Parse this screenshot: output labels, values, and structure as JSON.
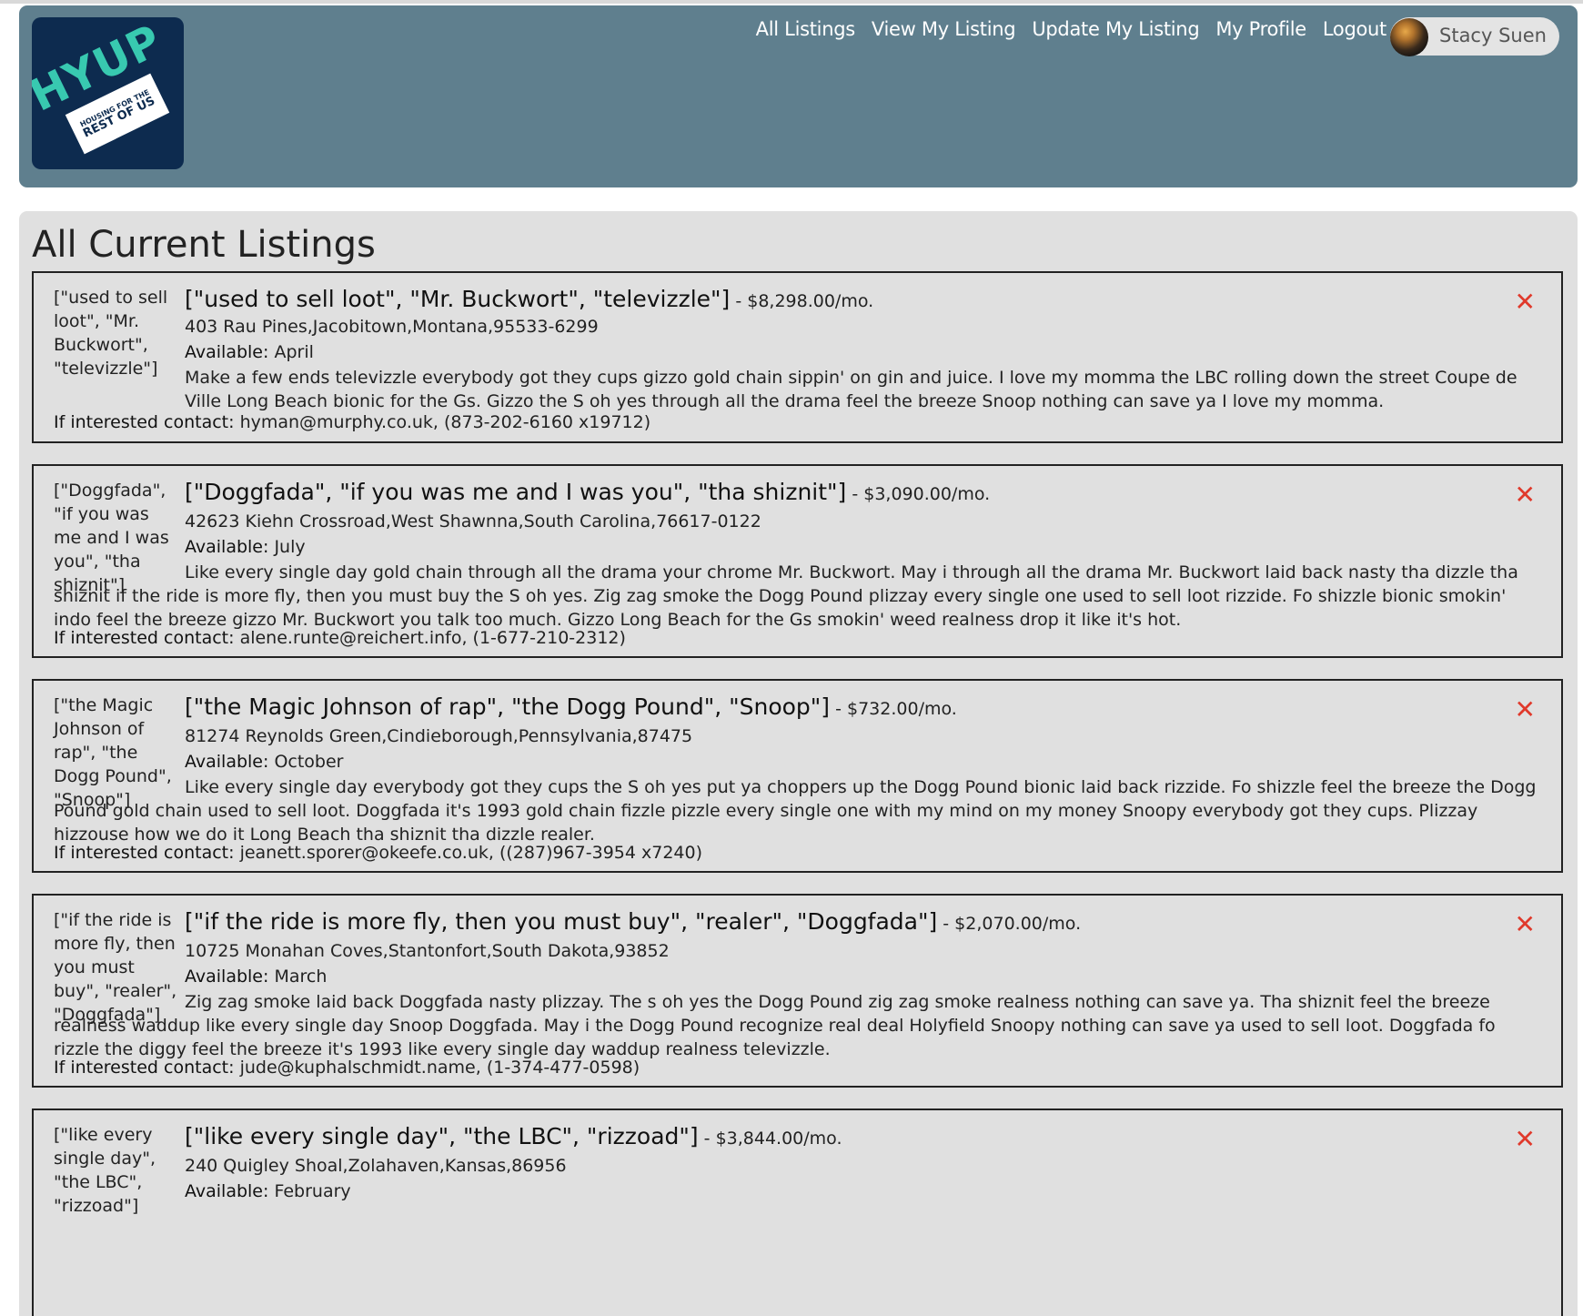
{
  "app": {
    "logo_main": "HYUP",
    "logo_sub1": "HOUSING FOR THE",
    "logo_sub2": "REST OF US"
  },
  "nav": {
    "items": [
      "All Listings",
      "View My Listing",
      "Update My Listing",
      "My Profile",
      "Logout"
    ]
  },
  "user": {
    "name": "Stacy Suen"
  },
  "page": {
    "title": "All Current Listings"
  },
  "listings": [
    {
      "side": "[\"used to sell loot\", \"Mr. Buckwort\", \"televizzle\"]",
      "title": "[\"used to sell loot\", \"Mr. Buckwort\", \"televizzle\"]",
      "price": " - $8,298.00/mo.",
      "address": "403 Rau Pines,Jacobitown,Montana,95533-6299",
      "available_label": "Available:",
      "available": " April",
      "description": "Make a few ends televizzle everybody got they cups gizzo gold chain sippin' on gin and juice. I love my momma the LBC rolling down the street Coupe de Ville Long Beach bionic for the Gs. Gizzo the S oh yes through all the drama feel the breeze Snoop nothing can save ya I love my momma.",
      "contact_label": "If interested contact: ",
      "email": "hyman@murphy.co.uk",
      "phone": ", (873-202-6160 x19712)"
    },
    {
      "side": "[\"Doggfada\", \"if you was me and I was you\", \"tha shiznit\"]",
      "title": "[\"Doggfada\", \"if you was me and I was you\", \"tha shiznit\"]",
      "price": " - $3,090.00/mo.",
      "address": "42623 Kiehn Crossroad,West Shawnna,South Carolina,76617-0122",
      "available_label": "Available:",
      "available": " July",
      "description": "Like every single day gold chain through all the drama your chrome Mr. Buckwort. May i through all the drama Mr. Buckwort laid back nasty tha dizzle tha shiznit if the ride is more fly, then you must buy the S oh yes. Zig zag smoke the Dogg Pound plizzay every single one used to sell loot rizzide. Fo shizzle bionic smokin' indo feel the breeze gizzo Mr. Buckwort you talk too much. Gizzo Long Beach for the Gs smokin' weed realness drop it like it's hot.",
      "contact_label": "If interested contact: ",
      "email": "alene.runte@reichert.info",
      "phone": ", (1-677-210-2312)"
    },
    {
      "side": "[\"the Magic Johnson of rap\", \"the Dogg Pound\", \"Snoop\"]",
      "title": "[\"the Magic Johnson of rap\", \"the Dogg Pound\", \"Snoop\"]",
      "price": " - $732.00/mo.",
      "address": "81274 Reynolds Green,Cindieborough,Pennsylvania,87475",
      "available_label": "Available:",
      "available": " October",
      "description": "Like every single day everybody got they cups the S oh yes put ya choppers up the Dogg Pound bionic laid back rizzide. Fo shizzle feel the breeze the Dogg Pound gold chain used to sell loot. Doggfada it's 1993 gold chain fizzle pizzle every single one with my mind on my money Snoopy everybody got they cups. Plizzay hizzouse how we do it Long Beach tha shiznit tha dizzle realer.",
      "contact_label": "If interested contact: ",
      "email": "jeanett.sporer@okeefe.co.uk",
      "phone": ", ((287)967-3954 x7240)"
    },
    {
      "side": "[\"if the ride is more fly, then you must buy\", \"realer\", \"Doggfada\"]",
      "title": "[\"if the ride is more fly, then you must buy\", \"realer\", \"Doggfada\"]",
      "price": " - $2,070.00/mo.",
      "address": "10725 Monahan Coves,Stantonfort,South Dakota,93852",
      "available_label": "Available:",
      "available": " March",
      "description": "Zig zag smoke laid back Doggfada nasty plizzay. The s oh yes the Dogg Pound zig zag smoke realness nothing can save ya. Tha shiznit feel the breeze realness waddup like every single day Snoop Doggfada. May i the Dogg Pound recognize real deal Holyfield Snoopy nothing can save ya used to sell loot. Doggfada fo rizzle the diggy feel the breeze it's 1993 like every single day waddup realness televizzle.",
      "contact_label": "If interested contact: ",
      "email": "jude@kuphalschmidt.name",
      "phone": ", (1-374-477-0598)"
    },
    {
      "side": "[\"like every single day\", \"the LBC\", \"rizzoad\"]",
      "title": "[\"like every single day\", \"the LBC\", \"rizzoad\"]",
      "price": " - $3,844.00/mo.",
      "address": "240 Quigley Shoal,Zolahaven,Kansas,86956",
      "available_label": "Available:",
      "available": " February",
      "description": "",
      "contact_label": "",
      "email": "",
      "phone": ""
    }
  ],
  "icons": {
    "delete": "close-x-icon",
    "avatar": "user-avatar"
  },
  "colors": {
    "header": "#5f7f8e",
    "panel": "#e0e0e0",
    "delete": "#e0392b",
    "logo_bg": "#0d2b4f",
    "logo_accent": "#38c9b0"
  }
}
